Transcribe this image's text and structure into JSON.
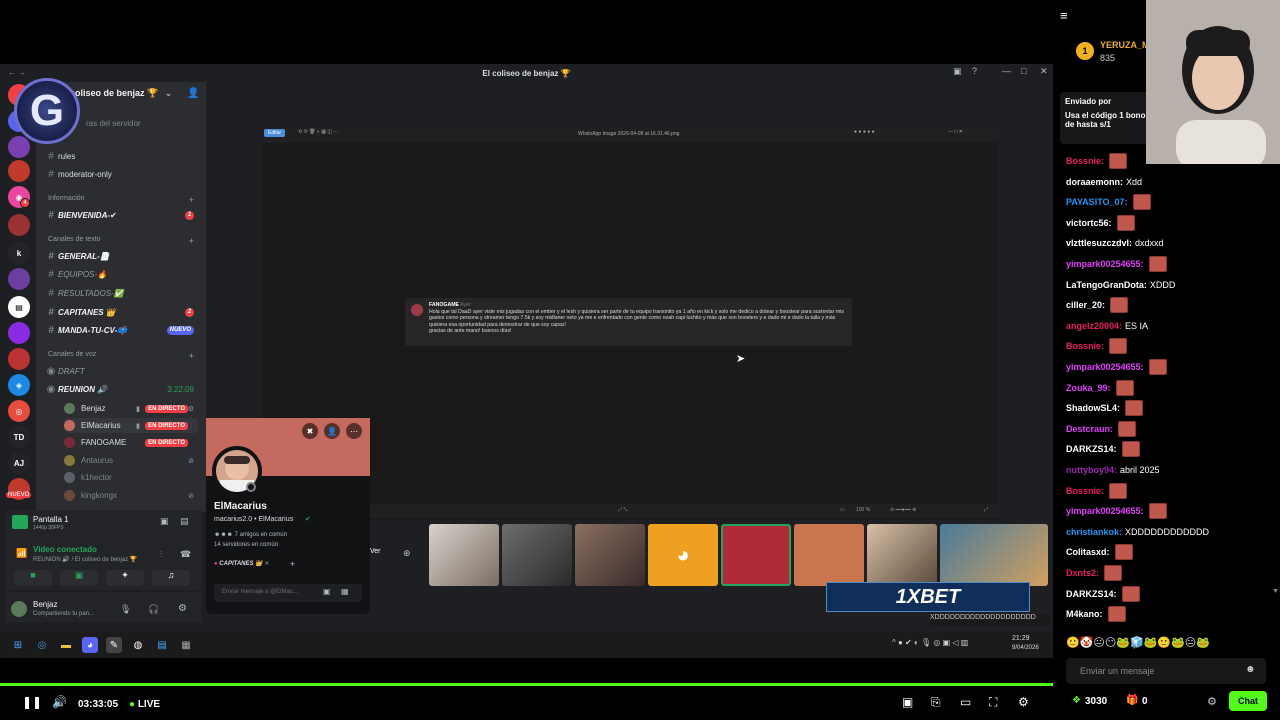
{
  "discord": {
    "window_title": "El coliseo de benjaz 🏆",
    "server_name": "coliseo de benjaz 🏆",
    "server_hint": "ras del servidor",
    "rail_labels": {
      "k": "k",
      "td": "TD",
      "aj": "AJ",
      "nuevo": "NUEVO"
    },
    "channels_top": [
      {
        "name": "rules"
      },
      {
        "name": "moderator-only"
      }
    ],
    "cat_info": "Información",
    "info_channels": [
      {
        "name": "BIENVENIDA-✔",
        "badge": "1"
      }
    ],
    "cat_text": "Canales de texto",
    "text_channels": [
      {
        "name": "GENERAL-📄",
        "bold": true
      },
      {
        "name": "EQUIPOS-🔥",
        "bold": false
      },
      {
        "name": "RESULTADOS-✅",
        "bold": false
      },
      {
        "name": "CAPITANES 👑",
        "bold": true,
        "badge": "2"
      },
      {
        "name": "MANDA-TU-CV-📫",
        "bold": true,
        "badge": "NUEVO"
      }
    ],
    "cat_voice": "Canales de voz",
    "voice_channels": [
      {
        "name": "DRAFT"
      },
      {
        "name": "REUNION 🔊",
        "time": "3:22:09"
      }
    ],
    "voice_users": [
      {
        "name": "Benjaz",
        "live": "EN DIRECTO"
      },
      {
        "name": "ElMacarius",
        "live": "EN DIRECTO"
      },
      {
        "name": "FANOGAME",
        "live": "EN DIRECTO"
      },
      {
        "name": "Antaurus",
        "live": ""
      },
      {
        "name": "k1hector",
        "live": ""
      },
      {
        "name": "kingkongx",
        "live": ""
      }
    ],
    "screen_share": {
      "title": "Pantalla 1",
      "sub": "1440p 30FPS"
    },
    "voice_status": {
      "title": "Video conectado",
      "sub": "REUNION 🔊 / El coliseo de benjaz 🏆"
    },
    "user": {
      "name": "Benjaz",
      "status": "Compartiendo tu pan..."
    },
    "profile": {
      "display_name": "ElMacarius",
      "handle": "macarius2.0 • ElMacarius",
      "friends": "7 amigos en común",
      "servers": "14 servidores en común",
      "role": "CAPITANES 👑",
      "message_placeholder": "Enviar mensaje a @ElMac..."
    },
    "ver_label": "Ver",
    "taskbar": {
      "time": "21:29",
      "date": "9/04/2026"
    }
  },
  "shared_screen": {
    "viewer_title": "WhatsApp Image 2026-04-08 at 16.31.46.png",
    "editor_button": "Editar",
    "zoom": "100 %",
    "sender": "FANOGAME",
    "sender_meta": "Ayer",
    "message": "Hola que tal DaaD ayer viste mis jugadas con el ember y el lesh y quisiera ser parte de tu equipo transmito ya 1 año en kick y solo me dedico a dotear y boostear para sustentar mis gastos como persona y streamer tengo 7.5k y soy midlaner neto ya me e enfrentado con gente como noah capi luchito y más que son boosters y e dado mi e dado la talla y más quisiera esa oportunidad para demostrar de que soy capaz!",
    "message_end": "gracias de ante mano! buenos días!"
  },
  "sponsor": "1XBET",
  "ticker": "XDDDDDDDDDDDDDDDDDDDD",
  "player": {
    "time": "03:33:05",
    "live": "LIVE",
    "progress": 1.0,
    "colors": {
      "accent": "#53fc18"
    }
  },
  "chat": {
    "leader_name": "YERUZA_M",
    "leader_points": "835",
    "leader_rank": "1",
    "pinned_by": "Enviado por",
    "pinned_text": "Usa el código 1 bono de hasta s/1",
    "messages": [
      {
        "user": "Bossnie:",
        "color": "#e91e63",
        "text": "",
        "emote": true
      },
      {
        "user": "doraaemonn:",
        "color": "#ffffff",
        "text": "Xdd",
        "emote": false
      },
      {
        "user": "PAYASITO_07:",
        "color": "#2196f3",
        "text": "",
        "emote": true
      },
      {
        "user": "victortc56:",
        "color": "#ffffff",
        "text": "",
        "emote": true
      },
      {
        "user": "vlzttlesuzczdvl:",
        "color": "#ffffff",
        "text": "dxdxxd",
        "emote": false
      },
      {
        "user": "yimpark00254655:",
        "color": "#e040fb",
        "text": "",
        "emote": true
      },
      {
        "user": "LaTengoGranDota:",
        "color": "#ffffff",
        "text": "XDDD",
        "emote": false
      },
      {
        "user": "ciller_20:",
        "color": "#ffffff",
        "text": "",
        "emote": true
      },
      {
        "user": "angelz20004:",
        "color": "#e91e63",
        "text": "ES IA",
        "emote": false
      },
      {
        "user": "Bossnie:",
        "color": "#e91e63",
        "text": "",
        "emote": true
      },
      {
        "user": "yimpark00254655:",
        "color": "#e040fb",
        "text": "",
        "emote": true
      },
      {
        "user": "Zouka_99:",
        "color": "#e040fb",
        "text": "",
        "emote": true
      },
      {
        "user": "ShadowSL4:",
        "color": "#ffffff",
        "text": "",
        "emote": true
      },
      {
        "user": "Destcraun:",
        "color": "#e040fb",
        "text": "",
        "emote": true
      },
      {
        "user": "DARKZS14:",
        "color": "#ffffff",
        "text": "",
        "emote": true
      },
      {
        "user": "nuttyboy94:",
        "color": "#9c27b0",
        "text": "abril 2025",
        "emote": false
      },
      {
        "user": "Bossnie:",
        "color": "#e91e63",
        "text": "",
        "emote": true
      },
      {
        "user": "yimpark00254655:",
        "color": "#e040fb",
        "text": "",
        "emote": true
      },
      {
        "user": "christiankok:",
        "color": "#2196f3",
        "text": "XDDDDDDDDDDDD",
        "emote": false
      },
      {
        "user": "Colitasxd:",
        "color": "#ffffff",
        "text": "",
        "emote": true
      },
      {
        "user": "Dxnts2:",
        "color": "#e91e63",
        "text": "",
        "emote": true
      },
      {
        "user": "DARKZS14:",
        "color": "#ffffff",
        "text": "",
        "emote": true
      },
      {
        "user": "M4kano:",
        "color": "#ffffff",
        "text": "",
        "emote": true
      }
    ],
    "input_placeholder": "Enviar un mensaje",
    "points": "3030",
    "gifts": "0",
    "chat_button": "Chat"
  }
}
